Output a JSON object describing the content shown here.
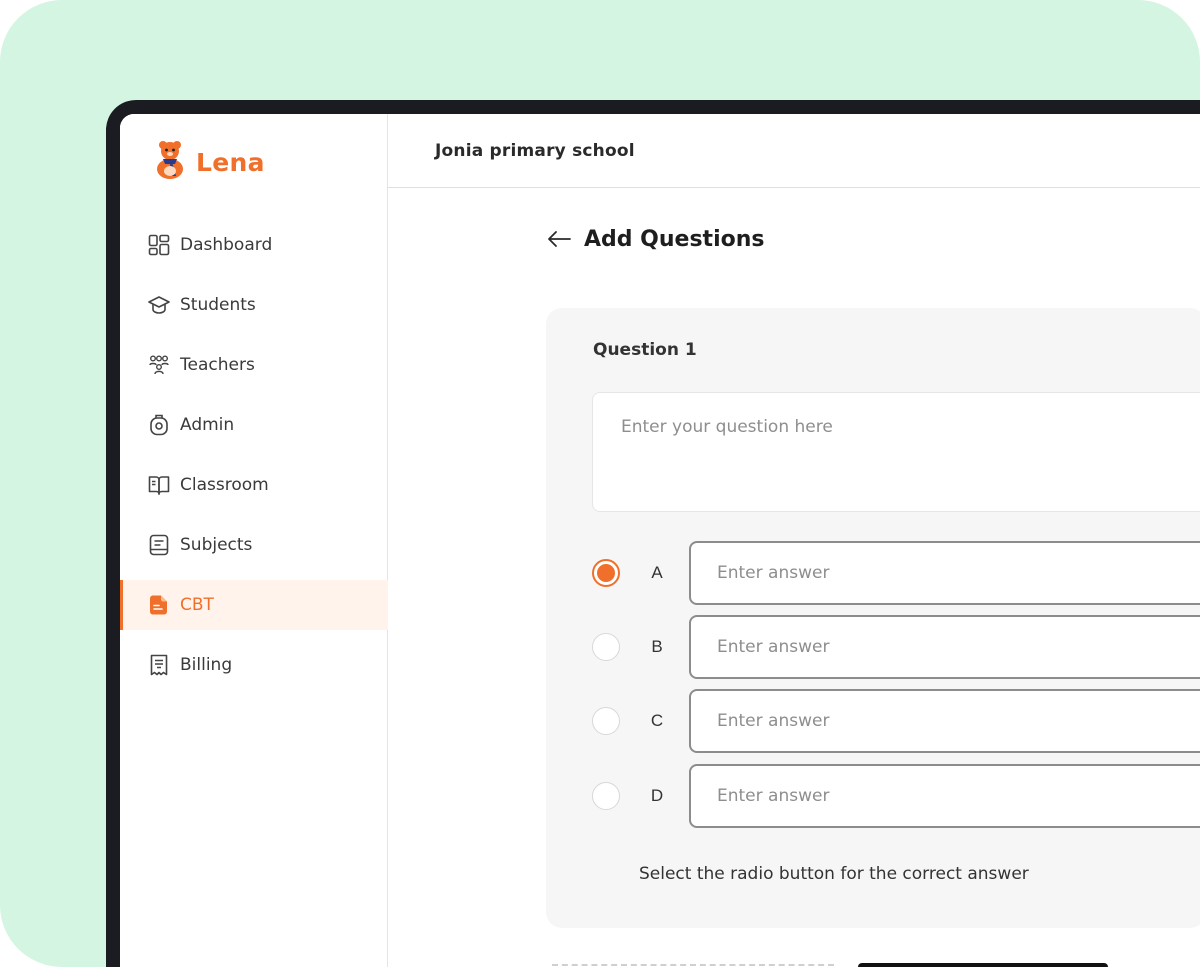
{
  "brand": {
    "name": "Lena",
    "accent": "#f0702b"
  },
  "header": {
    "school_name": "Jonia primary school"
  },
  "sidebar": {
    "items": [
      {
        "label": "Dashboard",
        "icon": "dashboard-icon",
        "active": false
      },
      {
        "label": "Students",
        "icon": "graduation-cap-icon",
        "active": false
      },
      {
        "label": "Teachers",
        "icon": "people-group-icon",
        "active": false
      },
      {
        "label": "Admin",
        "icon": "admin-badge-icon",
        "active": false
      },
      {
        "label": "Classroom",
        "icon": "open-book-icon",
        "active": false
      },
      {
        "label": "Subjects",
        "icon": "notebook-icon",
        "active": false
      },
      {
        "label": "CBT",
        "icon": "document-icon",
        "active": true
      },
      {
        "label": "Billing",
        "icon": "receipt-icon",
        "active": false
      }
    ]
  },
  "page": {
    "title": "Add Questions",
    "back_icon": "arrow-left-icon"
  },
  "question": {
    "label": "Question 1",
    "placeholder": "Enter your question here",
    "answers": [
      {
        "letter": "A",
        "placeholder": "Enter answer",
        "selected": true
      },
      {
        "letter": "B",
        "placeholder": "Enter answer",
        "selected": false
      },
      {
        "letter": "C",
        "placeholder": "Enter answer",
        "selected": false
      },
      {
        "letter": "D",
        "placeholder": "Enter answer",
        "selected": false
      }
    ],
    "hint": "Select the radio button for the correct answer"
  }
}
